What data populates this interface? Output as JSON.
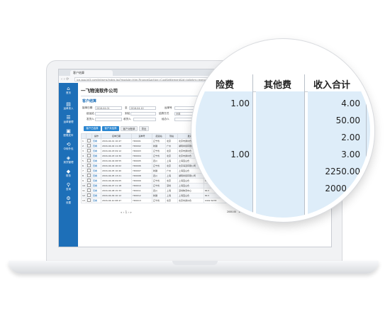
{
  "browser": {
    "tab_title": "客户结算",
    "url": "ice.app.bt3.com/bt/wms/index.jsp?module=htm.Finance&action=CustSettlement&id=jglbrkm=menu&ybkh"
  },
  "app": {
    "company_name": "一飞物流软件公司",
    "page_title": "客户结算"
  },
  "sidebar": {
    "items": [
      {
        "label": "首页",
        "icon": "home-icon"
      },
      {
        "label": "运单录入",
        "icon": "document-icon"
      },
      {
        "label": "运单管理",
        "icon": "list-icon"
      },
      {
        "label": "配载发车",
        "icon": "truck-icon"
      },
      {
        "label": "中转外包",
        "icon": "transfer-icon"
      },
      {
        "label": "到货管理",
        "icon": "box-icon"
      },
      {
        "label": "财务",
        "icon": "tag-icon"
      },
      {
        "label": "查询",
        "icon": "search-icon"
      },
      {
        "label": "设置",
        "icon": "gear-icon"
      }
    ]
  },
  "filters": {
    "row1": [
      {
        "label": "接单日期",
        "value": "2016-04-01"
      },
      {
        "label": "至",
        "value": "2016-04-10"
      },
      {
        "label": "运单号",
        "value": ""
      },
      {
        "label": "状态",
        "value": "全部"
      }
    ],
    "row2": [
      {
        "label": "起运站",
        "value": ""
      },
      {
        "label": "到站",
        "value": ""
      },
      {
        "label": "结算方式",
        "value": "全部"
      },
      {
        "label": "承运商",
        "value": ""
      }
    ],
    "row3": [
      {
        "label": "发货人",
        "value": ""
      },
      {
        "label": "收货人",
        "value": ""
      },
      {
        "label": "经办人",
        "value": ""
      }
    ],
    "query_button": "查询"
  },
  "toolbar": {
    "buttons": [
      "客户已结算",
      "客户未结算",
      "客户对账单",
      "导出"
    ]
  },
  "table": {
    "headers": [
      "",
      "",
      "操作",
      "接单日期",
      "运单号",
      "起运站",
      "到站",
      "发货人",
      "收货电话"
    ],
    "rows": [
      [
        "1",
        "",
        "查看",
        "2016-04-01 10:47",
        "YD0001",
        "辽宁省",
        "北京",
        "北京市通州仓",
        "0402 6278"
      ],
      [
        "2",
        "",
        "查看",
        "2016-04-02 11:28",
        "YD0002",
        "新疆",
        "广州",
        "湖南商贸有限公司",
        "0102 4278"
      ],
      [
        "3",
        "",
        "查看",
        "2016-04-03 09:12",
        "YD0003",
        "辽宁省",
        "北京",
        "北京市通州仓",
        "Del"
      ],
      [
        "4",
        "",
        "查看",
        "2016-04-03 14:30",
        "YD0004",
        "辽宁省",
        "北京",
        "北京市通州仓",
        "Del"
      ],
      [
        "5",
        "",
        "查看",
        "2016-04-04 08:55",
        "YD0005",
        "四川",
        "上海",
        "上海宝山仓",
        ""
      ],
      [
        "6",
        "",
        "查看",
        "2016-04-04 16:02",
        "YD0006",
        "辽宁省",
        "北京",
        "北京海淀有限公司",
        "0102 6278"
      ],
      [
        "7",
        "",
        "查看",
        "2016-04-05 10:40",
        "YD0007",
        "新疆",
        "广州",
        "上海宝山仓",
        "0402 6278"
      ],
      [
        "8",
        "",
        "查看",
        "2016-04-05 13:21",
        "YD0008",
        "四川",
        "上海",
        "湖南商贸有限公司",
        "0102 4278"
      ],
      [
        "9",
        "",
        "查看",
        "2016-04-06 09:05",
        "YD0009",
        "辽宁省",
        "北京",
        "上海宝山仓",
        "813"
      ],
      [
        "10",
        "",
        "查看",
        "2016-04-07 11:18",
        "YD0010",
        "辽宁省",
        "深圳",
        "上海宝山仓",
        ""
      ],
      [
        "11",
        "",
        "查看",
        "2016-04-08 15:33",
        "YD0011",
        "四川",
        "上海",
        "深圳物流中心",
        "813"
      ],
      [
        "12",
        "",
        "查看",
        "2016-04-09 10:12",
        "YD0012",
        "新疆",
        "上海",
        "上海宝山仓",
        "813"
      ],
      [
        "13",
        "",
        "查看",
        "2016-04-10 08:47",
        "YD0013",
        "辽宁省",
        "北京",
        "北京市通州仓",
        "0402 6278"
      ]
    ],
    "totals": [
      "2000.00",
      "1.00",
      "3.00",
      "2250.00"
    ],
    "pager": "« ‹ 1 › »"
  },
  "magnifier": {
    "headers": [
      "险费",
      "其他费",
      "收入合计"
    ],
    "col1": [
      "1.00",
      "",
      "",
      "1.00",
      "",
      ""
    ],
    "col2": [
      "",
      "",
      "",
      "",
      "",
      ""
    ],
    "col3": [
      "4.00",
      "50.00",
      "2.00",
      "3.00",
      "2250.00",
      "2000.00"
    ]
  }
}
